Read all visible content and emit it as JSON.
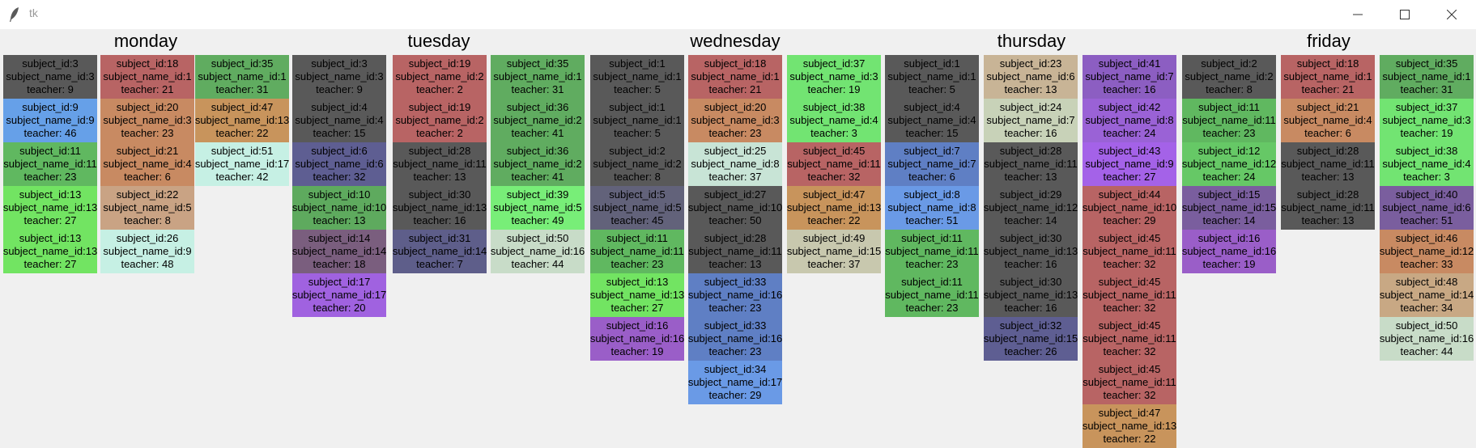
{
  "window": {
    "title": "tk"
  },
  "days": [
    {
      "name": "monday",
      "columns": [
        [
          {
            "subject_id": "subject_id:3",
            "subject_name_id": "subject_name_id:3",
            "teacher": "teacher: 9",
            "color": "#595959"
          },
          {
            "subject_id": "subject_id:9",
            "subject_name_id": "subject_name_id:9",
            "teacher": "teacher: 46",
            "color": "#66a0e8"
          },
          {
            "subject_id": "subject_id:11",
            "subject_name_id": "subject_name_id:11",
            "teacher": "teacher: 23",
            "color": "#60b860"
          },
          {
            "subject_id": "subject_id:13",
            "subject_name_id": "subject_name_id:13",
            "teacher": "teacher: 27",
            "color": "#72e462"
          },
          {
            "subject_id": "subject_id:13",
            "subject_name_id": "subject_name_id:13",
            "teacher": "teacher: 27",
            "color": "#72e462"
          }
        ],
        [
          {
            "subject_id": "subject_id:18",
            "subject_name_id": "subject_name_id:1",
            "teacher": "teacher: 21",
            "color": "#b86464"
          },
          {
            "subject_id": "subject_id:20",
            "subject_name_id": "subject_name_id:3",
            "teacher": "teacher: 23",
            "color": "#c88a62"
          },
          {
            "subject_id": "subject_id:21",
            "subject_name_id": "subject_name_id:4",
            "teacher": "teacher: 6",
            "color": "#c88a62"
          },
          {
            "subject_id": "subject_id:22",
            "subject_name_id": "subject_name_id:5",
            "teacher": "teacher: 8",
            "color": "#c9a384"
          },
          {
            "subject_id": "subject_id:26",
            "subject_name_id": "subject_name_id:9",
            "teacher": "teacher: 48",
            "color": "#c6f0e4"
          }
        ],
        [
          {
            "subject_id": "subject_id:35",
            "subject_name_id": "subject_name_id:1",
            "teacher": "teacher: 31",
            "color": "#60ac60"
          },
          {
            "subject_id": "subject_id:47",
            "subject_name_id": "subject_name_id:13",
            "teacher": "teacher: 22",
            "color": "#c8945c"
          },
          {
            "subject_id": "subject_id:51",
            "subject_name_id": "subject_name_id:17",
            "teacher": "teacher: 42",
            "color": "#c6f0e4"
          }
        ]
      ]
    },
    {
      "name": "tuesday",
      "columns": [
        [
          {
            "subject_id": "subject_id:3",
            "subject_name_id": "subject_name_id:3",
            "teacher": "teacher: 9",
            "color": "#595959"
          },
          {
            "subject_id": "subject_id:4",
            "subject_name_id": "subject_name_id:4",
            "teacher": "teacher: 15",
            "color": "#595959"
          },
          {
            "subject_id": "subject_id:6",
            "subject_name_id": "subject_name_id:6",
            "teacher": "teacher: 32",
            "color": "#5e5e92"
          },
          {
            "subject_id": "subject_id:10",
            "subject_name_id": "subject_name_id:10",
            "teacher": "teacher: 13",
            "color": "#5eaa5e"
          },
          {
            "subject_id": "subject_id:14",
            "subject_name_id": "subject_name_id:14",
            "teacher": "teacher: 18",
            "color": "#7a5e7e"
          },
          {
            "subject_id": "subject_id:17",
            "subject_name_id": "subject_name_id:17",
            "teacher": "teacher: 20",
            "color": "#a062e0"
          }
        ],
        [
          {
            "subject_id": "subject_id:19",
            "subject_name_id": "subject_name_id:2",
            "teacher": "teacher: 2",
            "color": "#b86464"
          },
          {
            "subject_id": "subject_id:19",
            "subject_name_id": "subject_name_id:2",
            "teacher": "teacher: 2",
            "color": "#b86464"
          },
          {
            "subject_id": "subject_id:28",
            "subject_name_id": "subject_name_id:11",
            "teacher": "teacher: 13",
            "color": "#595959"
          },
          {
            "subject_id": "subject_id:30",
            "subject_name_id": "subject_name_id:13",
            "teacher": "teacher: 16",
            "color": "#595959"
          },
          {
            "subject_id": "subject_id:31",
            "subject_name_id": "subject_name_id:14",
            "teacher": "teacher: 7",
            "color": "#5e5e8a"
          }
        ],
        [
          {
            "subject_id": "subject_id:35",
            "subject_name_id": "subject_name_id:1",
            "teacher": "teacher: 31",
            "color": "#60ac60"
          },
          {
            "subject_id": "subject_id:36",
            "subject_name_id": "subject_name_id:2",
            "teacher": "teacher: 41",
            "color": "#60ac60"
          },
          {
            "subject_id": "subject_id:36",
            "subject_name_id": "subject_name_id:2",
            "teacher": "teacher: 41",
            "color": "#60ac60"
          },
          {
            "subject_id": "subject_id:39",
            "subject_name_id": "subject_name_id:5",
            "teacher": "teacher: 49",
            "color": "#78ee78"
          },
          {
            "subject_id": "subject_id:50",
            "subject_name_id": "subject_name_id:16",
            "teacher": "teacher: 44",
            "color": "#c8dcc8"
          }
        ]
      ]
    },
    {
      "name": "wednesday",
      "columns": [
        [
          {
            "subject_id": "subject_id:1",
            "subject_name_id": "subject_name_id:1",
            "teacher": "teacher: 5",
            "color": "#595959"
          },
          {
            "subject_id": "subject_id:1",
            "subject_name_id": "subject_name_id:1",
            "teacher": "teacher: 5",
            "color": "#595959"
          },
          {
            "subject_id": "subject_id:2",
            "subject_name_id": "subject_name_id:2",
            "teacher": "teacher: 8",
            "color": "#595959"
          },
          {
            "subject_id": "subject_id:5",
            "subject_name_id": "subject_name_id:5",
            "teacher": "teacher: 45",
            "color": "#62627a"
          },
          {
            "subject_id": "subject_id:11",
            "subject_name_id": "subject_name_id:11",
            "teacher": "teacher: 23",
            "color": "#60b860"
          },
          {
            "subject_id": "subject_id:13",
            "subject_name_id": "subject_name_id:13",
            "teacher": "teacher: 27",
            "color": "#72e462"
          },
          {
            "subject_id": "subject_id:16",
            "subject_name_id": "subject_name_id:16",
            "teacher": "teacher: 19",
            "color": "#9a5ec8"
          }
        ],
        [
          {
            "subject_id": "subject_id:18",
            "subject_name_id": "subject_name_id:1",
            "teacher": "teacher: 21",
            "color": "#b86464"
          },
          {
            "subject_id": "subject_id:20",
            "subject_name_id": "subject_name_id:3",
            "teacher": "teacher: 23",
            "color": "#c88a62"
          },
          {
            "subject_id": "subject_id:25",
            "subject_name_id": "subject_name_id:8",
            "teacher": "teacher: 37",
            "color": "#c8e4d6"
          },
          {
            "subject_id": "subject_id:27",
            "subject_name_id": "subject_name_id:10",
            "teacher": "teacher: 50",
            "color": "#595959"
          },
          {
            "subject_id": "subject_id:28",
            "subject_name_id": "subject_name_id:11",
            "teacher": "teacher: 13",
            "color": "#595959"
          },
          {
            "subject_id": "subject_id:33",
            "subject_name_id": "subject_name_id:16",
            "teacher": "teacher: 23",
            "color": "#5f7fc4"
          },
          {
            "subject_id": "subject_id:33",
            "subject_name_id": "subject_name_id:16",
            "teacher": "teacher: 23",
            "color": "#5f7fc4"
          },
          {
            "subject_id": "subject_id:34",
            "subject_name_id": "subject_name_id:17",
            "teacher": "teacher: 29",
            "color": "#6a9ae6"
          }
        ],
        [
          {
            "subject_id": "subject_id:37",
            "subject_name_id": "subject_name_id:3",
            "teacher": "teacher: 19",
            "color": "#72e472"
          },
          {
            "subject_id": "subject_id:38",
            "subject_name_id": "subject_name_id:4",
            "teacher": "teacher: 3",
            "color": "#72e472"
          },
          {
            "subject_id": "subject_id:45",
            "subject_name_id": "subject_name_id:11",
            "teacher": "teacher: 32",
            "color": "#b86464"
          },
          {
            "subject_id": "subject_id:47",
            "subject_name_id": "subject_name_id:13",
            "teacher": "teacher: 22",
            "color": "#c8945c"
          },
          {
            "subject_id": "subject_id:49",
            "subject_name_id": "subject_name_id:15",
            "teacher": "teacher: 37",
            "color": "#c8c8ae"
          }
        ]
      ]
    },
    {
      "name": "thursday",
      "columns": [
        [
          {
            "subject_id": "subject_id:1",
            "subject_name_id": "subject_name_id:1",
            "teacher": "teacher: 5",
            "color": "#595959"
          },
          {
            "subject_id": "subject_id:4",
            "subject_name_id": "subject_name_id:4",
            "teacher": "teacher: 15",
            "color": "#595959"
          },
          {
            "subject_id": "subject_id:7",
            "subject_name_id": "subject_name_id:7",
            "teacher": "teacher: 6",
            "color": "#5f7fc4"
          },
          {
            "subject_id": "subject_id:8",
            "subject_name_id": "subject_name_id:8",
            "teacher": "teacher: 51",
            "color": "#6a9ae6"
          },
          {
            "subject_id": "subject_id:11",
            "subject_name_id": "subject_name_id:11",
            "teacher": "teacher: 23",
            "color": "#60b860"
          },
          {
            "subject_id": "subject_id:11",
            "subject_name_id": "subject_name_id:11",
            "teacher": "teacher: 23",
            "color": "#60b860"
          }
        ],
        [
          {
            "subject_id": "subject_id:23",
            "subject_name_id": "subject_name_id:6",
            "teacher": "teacher: 13",
            "color": "#c8b496"
          },
          {
            "subject_id": "subject_id:24",
            "subject_name_id": "subject_name_id:7",
            "teacher": "teacher: 16",
            "color": "#c8d2b8"
          },
          {
            "subject_id": "subject_id:28",
            "subject_name_id": "subject_name_id:11",
            "teacher": "teacher: 13",
            "color": "#595959"
          },
          {
            "subject_id": "subject_id:29",
            "subject_name_id": "subject_name_id:12",
            "teacher": "teacher: 14",
            "color": "#595959"
          },
          {
            "subject_id": "subject_id:30",
            "subject_name_id": "subject_name_id:13",
            "teacher": "teacher: 16",
            "color": "#595959"
          },
          {
            "subject_id": "subject_id:30",
            "subject_name_id": "subject_name_id:13",
            "teacher": "teacher: 16",
            "color": "#595959"
          },
          {
            "subject_id": "subject_id:32",
            "subject_name_id": "subject_name_id:15",
            "teacher": "teacher: 26",
            "color": "#5e5e92"
          }
        ],
        [
          {
            "subject_id": "subject_id:41",
            "subject_name_id": "subject_name_id:7",
            "teacher": "teacher: 16",
            "color": "#8c5ec2"
          },
          {
            "subject_id": "subject_id:42",
            "subject_name_id": "subject_name_id:8",
            "teacher": "teacher: 24",
            "color": "#9a62d6"
          },
          {
            "subject_id": "subject_id:43",
            "subject_name_id": "subject_name_id:9",
            "teacher": "teacher: 27",
            "color": "#a462e8"
          },
          {
            "subject_id": "subject_id:44",
            "subject_name_id": "subject_name_id:10",
            "teacher": "teacher: 29",
            "color": "#b86464"
          },
          {
            "subject_id": "subject_id:45",
            "subject_name_id": "subject_name_id:11",
            "teacher": "teacher: 32",
            "color": "#b86464"
          },
          {
            "subject_id": "subject_id:45",
            "subject_name_id": "subject_name_id:11",
            "teacher": "teacher: 32",
            "color": "#b86464"
          },
          {
            "subject_id": "subject_id:45",
            "subject_name_id": "subject_name_id:11",
            "teacher": "teacher: 32",
            "color": "#b86464"
          },
          {
            "subject_id": "subject_id:45",
            "subject_name_id": "subject_name_id:11",
            "teacher": "teacher: 32",
            "color": "#b86464"
          },
          {
            "subject_id": "subject_id:47",
            "subject_name_id": "subject_name_id:13",
            "teacher": "teacher: 22",
            "color": "#c8945c"
          }
        ]
      ]
    },
    {
      "name": "friday",
      "columns": [
        [
          {
            "subject_id": "subject_id:2",
            "subject_name_id": "subject_name_id:2",
            "teacher": "teacher: 8",
            "color": "#595959"
          },
          {
            "subject_id": "subject_id:11",
            "subject_name_id": "subject_name_id:11",
            "teacher": "teacher: 23",
            "color": "#60b860"
          },
          {
            "subject_id": "subject_id:12",
            "subject_name_id": "subject_name_id:12",
            "teacher": "teacher: 24",
            "color": "#66c866"
          },
          {
            "subject_id": "subject_id:15",
            "subject_name_id": "subject_name_id:15",
            "teacher": "teacher: 14",
            "color": "#7a5e9e"
          },
          {
            "subject_id": "subject_id:16",
            "subject_name_id": "subject_name_id:16",
            "teacher": "teacher: 19",
            "color": "#9a5ec8"
          }
        ],
        [
          {
            "subject_id": "subject_id:18",
            "subject_name_id": "subject_name_id:1",
            "teacher": "teacher: 21",
            "color": "#b86464"
          },
          {
            "subject_id": "subject_id:21",
            "subject_name_id": "subject_name_id:4",
            "teacher": "teacher: 6",
            "color": "#c88a62"
          },
          {
            "subject_id": "subject_id:28",
            "subject_name_id": "subject_name_id:11",
            "teacher": "teacher: 13",
            "color": "#595959"
          },
          {
            "subject_id": "subject_id:28",
            "subject_name_id": "subject_name_id:11",
            "teacher": "teacher: 13",
            "color": "#595959"
          }
        ],
        [
          {
            "subject_id": "subject_id:35",
            "subject_name_id": "subject_name_id:1",
            "teacher": "teacher: 31",
            "color": "#60ac60"
          },
          {
            "subject_id": "subject_id:37",
            "subject_name_id": "subject_name_id:3",
            "teacher": "teacher: 19",
            "color": "#72e472"
          },
          {
            "subject_id": "subject_id:38",
            "subject_name_id": "subject_name_id:4",
            "teacher": "teacher: 3",
            "color": "#72e472"
          },
          {
            "subject_id": "subject_id:40",
            "subject_name_id": "subject_name_id:6",
            "teacher": "teacher: 51",
            "color": "#7a5e9e"
          },
          {
            "subject_id": "subject_id:46",
            "subject_name_id": "subject_name_id:12",
            "teacher": "teacher: 33",
            "color": "#c88a62"
          },
          {
            "subject_id": "subject_id:48",
            "subject_name_id": "subject_name_id:14",
            "teacher": "teacher: 34",
            "color": "#c8a884"
          },
          {
            "subject_id": "subject_id:50",
            "subject_name_id": "subject_name_id:16",
            "teacher": "teacher: 44",
            "color": "#c8dcc8"
          }
        ]
      ]
    }
  ]
}
